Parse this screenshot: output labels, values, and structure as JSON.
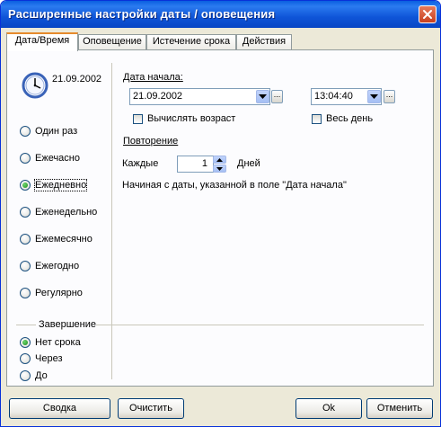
{
  "window": {
    "title": "Расширенные настройки даты / оповещения"
  },
  "tabs": [
    {
      "label": "Дата/Время",
      "active": true
    },
    {
      "label": "Оповещение",
      "active": false
    },
    {
      "label": "Истечение срока",
      "active": false
    },
    {
      "label": "Действия",
      "active": false
    }
  ],
  "sidebar": {
    "date": "21.09.2002",
    "recurrence": [
      {
        "label": "Один раз",
        "checked": false
      },
      {
        "label": "Ежечасно",
        "checked": false
      },
      {
        "label": "Ежедневно",
        "checked": true
      },
      {
        "label": "Еженедельно",
        "checked": false
      },
      {
        "label": "Ежемесячно",
        "checked": false
      },
      {
        "label": "Ежегодно",
        "checked": false
      },
      {
        "label": "Регулярно",
        "checked": false
      }
    ],
    "ending": {
      "title": "Завершение",
      "options": [
        {
          "label": "Нет срока",
          "checked": true
        },
        {
          "label": "Через",
          "checked": false
        },
        {
          "label": "До",
          "checked": false
        }
      ]
    }
  },
  "main": {
    "start_date_label": "Дата начала:",
    "start_date_value": "21.09.2002",
    "start_time_value": "13:04:40",
    "calc_age_label": "Вычислять возраст",
    "all_day_label": "Весь день",
    "repeat_label": "Повторение",
    "every_label": "Каждые",
    "every_value": "1",
    "days_label": "Дней",
    "note": "Начиная с даты, указанной в поле \"Дата начала\"",
    "ellipsis": "..."
  },
  "buttons": {
    "summary": "Сводка",
    "clear": "Очистить",
    "ok": "Ok",
    "cancel": "Отменить"
  }
}
